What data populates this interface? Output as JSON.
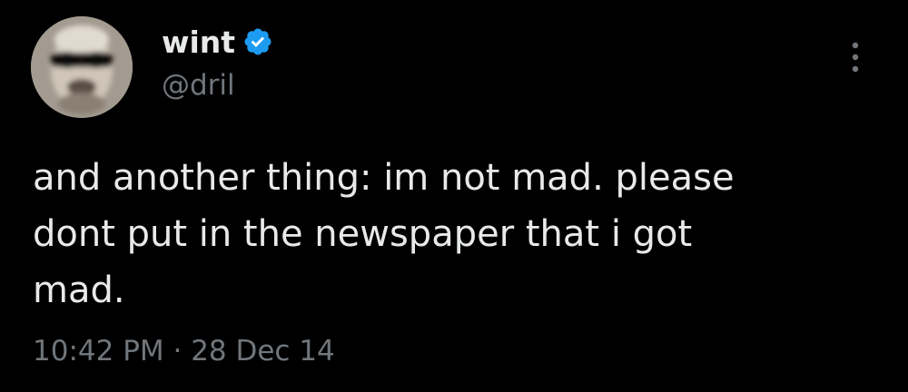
{
  "tweet": {
    "author": {
      "display_name": "wint",
      "handle": "@dril",
      "verified": true,
      "avatar_icon": "avatar"
    },
    "text": "and another thing: im not mad. please\ndont put in the newspaper that i got\nmad.",
    "timestamp": "10:42 PM · 28 Dec 14",
    "menu_icon": "more-options-icon"
  },
  "colors": {
    "background": "#000000",
    "text_primary": "#e7e9ea",
    "text_secondary": "#71767b",
    "verified_blue": "#1d9bf0"
  }
}
